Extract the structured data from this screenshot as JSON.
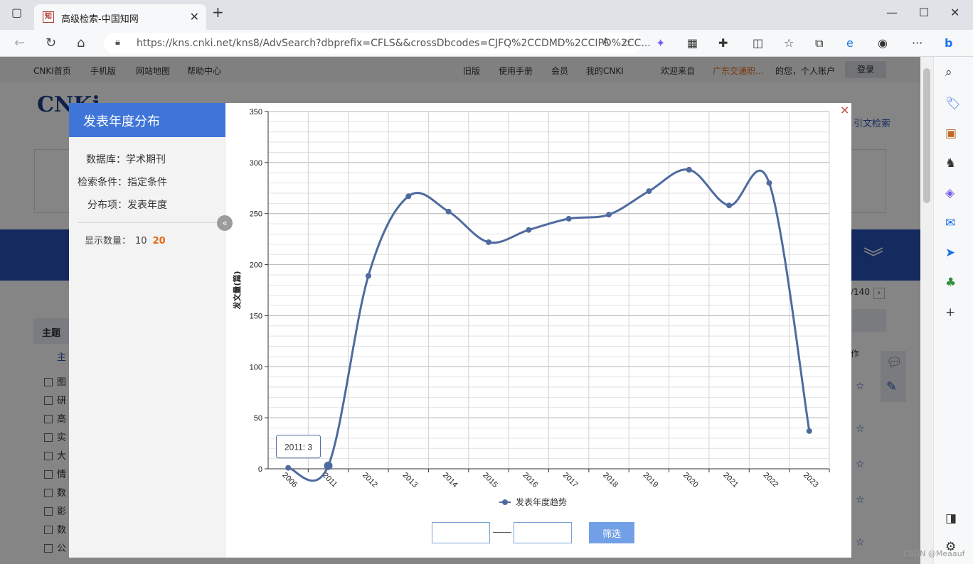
{
  "browser": {
    "tab_title": "高级检索-中国知网",
    "tab_icon_text": "知",
    "url": "https://kns.cnki.net/kns8/AdvSearch?dbprefix=CFLS&&crossDbcodes=CJFQ%2CCDMD%2CCIPD%2CC..."
  },
  "site": {
    "topnav": [
      "CNKI首页",
      "手机版",
      "网站地图",
      "帮助中心",
      "旧版",
      "使用手册",
      "会员",
      "我的CNKI",
      "欢迎来自",
      "广东交通职...",
      "的您，个人账户"
    ],
    "login": "登录",
    "logo": "CNKi",
    "ref_search": "引文检索",
    "topic": "主题",
    "topic_sub": "主",
    "pager": "/140",
    "ops": "作",
    "checkbox_items": [
      "图",
      "研",
      "高",
      "实",
      "大",
      "情",
      "数",
      "影",
      "数",
      "公"
    ]
  },
  "dialog": {
    "title": "发表年度分布",
    "db_label": "数据库：",
    "db_value": "学术期刊",
    "cond_label": "检索条件：",
    "cond_value": "指定条件",
    "dist_label": "分布项：",
    "dist_value": "发表年度",
    "count_label": "显示数量：",
    "count_opt1": "10",
    "count_opt2": "20",
    "close": "×",
    "collapse": "«",
    "filter_button": "筛选",
    "filter_from": "",
    "filter_to": ""
  },
  "chart_data": {
    "type": "line",
    "categories": [
      "2006",
      "2011",
      "2012",
      "2013",
      "2014",
      "2015",
      "2016",
      "2017",
      "2018",
      "2019",
      "2020",
      "2021",
      "2022",
      "2023"
    ],
    "series": [
      {
        "name": "发表年度趋势",
        "values": [
          1,
          3,
          189,
          267,
          252,
          222,
          234,
          245,
          249,
          272,
          293,
          258,
          280,
          37
        ]
      }
    ],
    "ylabel": "发文量(篇)",
    "ylim": [
      0,
      350
    ],
    "yticks": [
      0,
      50,
      100,
      150,
      200,
      250,
      300,
      350
    ],
    "grid": true,
    "legend": "bottom",
    "tooltip": "2011: 3",
    "color": "#4f6b9f"
  },
  "watermark": "CSDN @Meaauf"
}
